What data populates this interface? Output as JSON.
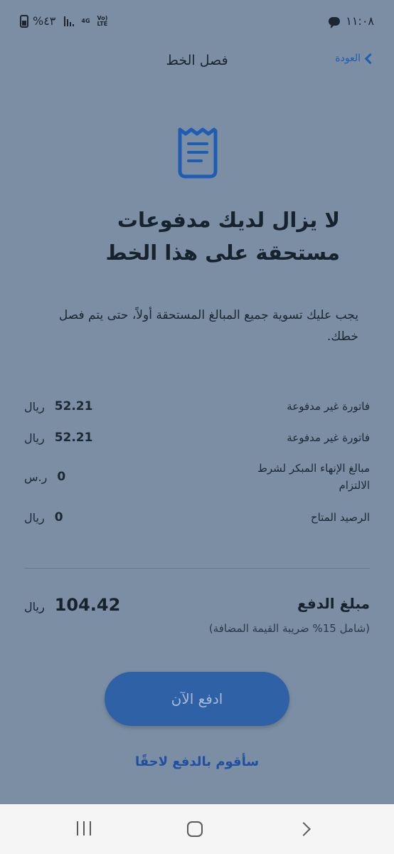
{
  "status_bar": {
    "battery_percent": "%٤٣",
    "network_gen": "4G",
    "network_lte": "Vo) LTE",
    "time": "١١:٠٨"
  },
  "header": {
    "back_label": "العودة",
    "title": "فصل الخط"
  },
  "headline": "لا يزال لديك مدفوعات مستحقة على هذا الخط",
  "description": "يجب عليك تسوية جميع المبالغ المستحقة أولاً، حتى يتم فصل خطك.",
  "rows": [
    {
      "label": "فاتورة غير مدفوعة",
      "value": "52.21",
      "currency": "ريال"
    },
    {
      "label": "فاتورة غير مدفوعة",
      "value": "52.21",
      "currency": "ريال"
    },
    {
      "label": "مبالغ الإنهاء المبكر لشرط الالتزام",
      "value": "0",
      "currency": "ر.س"
    },
    {
      "label": "الرصيد المتاح",
      "value": "0",
      "currency": "ريال"
    }
  ],
  "total": {
    "label": "مبلغ الدفع",
    "note": "(شامل 15% ضريبة القيمة المضافة)",
    "value": "104.42",
    "currency": "ريال"
  },
  "actions": {
    "pay_now": "ادفع الآن",
    "pay_later": "سأقوم بالدفع لاحقًا"
  },
  "colors": {
    "overlay_background": "#7b8ea3",
    "accent": "#1f5db5",
    "button": "#2f61a6"
  }
}
